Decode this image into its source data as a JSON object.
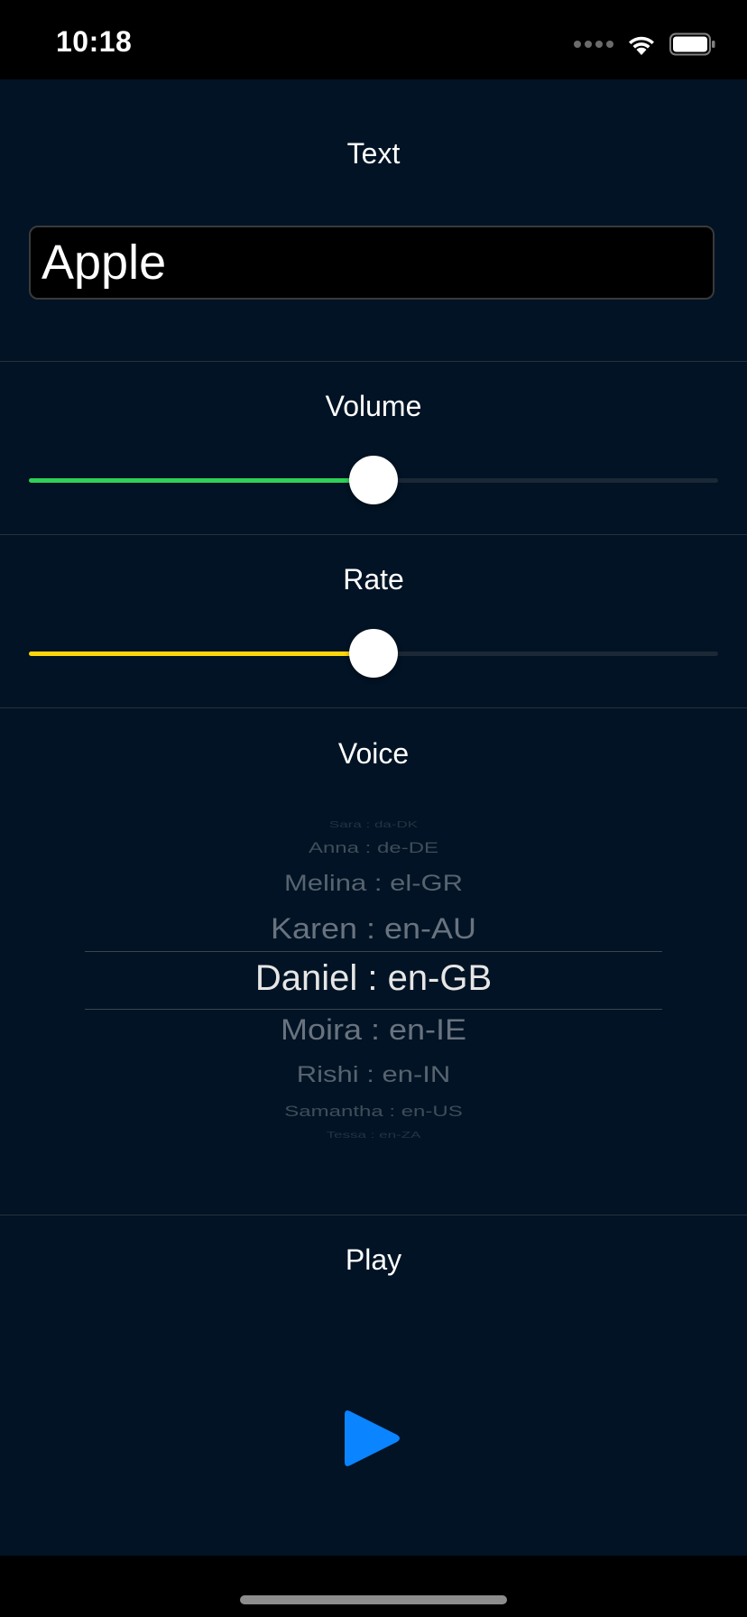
{
  "status_bar": {
    "time": "10:18",
    "icons": [
      "signal-dots-icon",
      "wifi-icon",
      "battery-icon"
    ]
  },
  "text_section": {
    "title": "Text",
    "input_value": "Apple"
  },
  "volume_section": {
    "title": "Volume",
    "value": 0.5,
    "accent_color": "#30d158"
  },
  "rate_section": {
    "title": "Rate",
    "value": 0.5,
    "accent_color": "#ffd60a"
  },
  "voice_section": {
    "title": "Voice",
    "options": [
      "Sara : da-DK",
      "Anna : de-DE",
      "Melina : el-GR",
      "Karen : en-AU",
      "Daniel : en-GB",
      "Moira : en-IE",
      "Rishi : en-IN",
      "Samantha : en-US",
      "Tessa : en-ZA"
    ],
    "selected": "Daniel : en-GB"
  },
  "play_section": {
    "title": "Play",
    "button_icon": "play-icon",
    "button_color": "#0a84ff"
  }
}
